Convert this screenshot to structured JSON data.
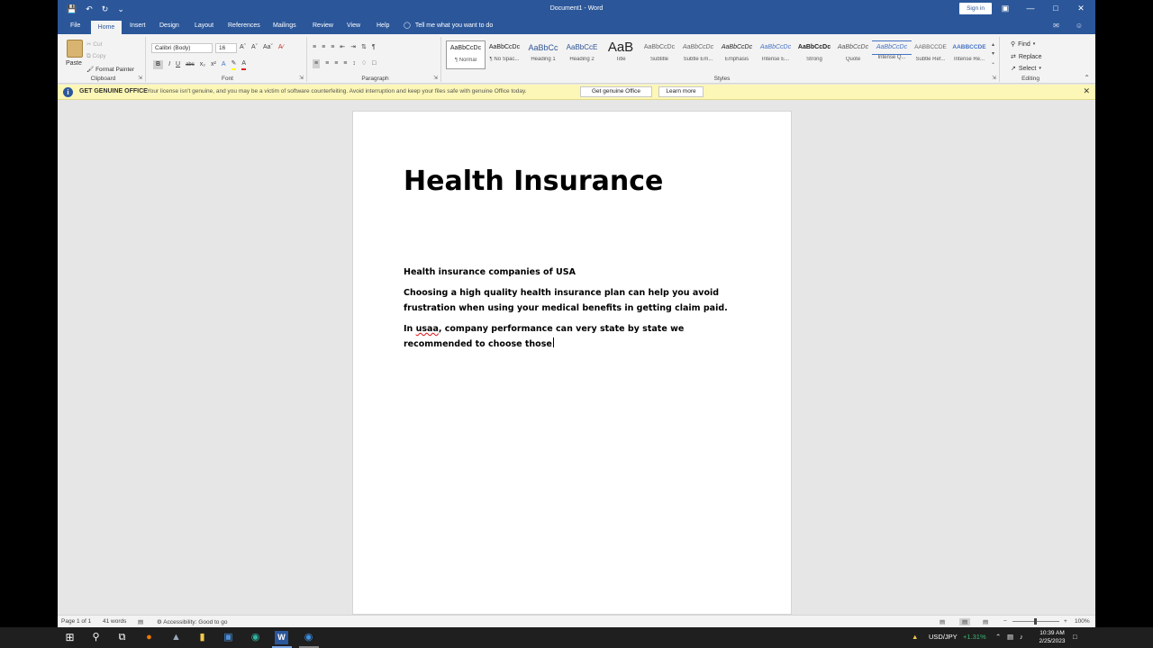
{
  "window": {
    "title": "Document1 - Word",
    "signin": "Sign in"
  },
  "tabs": [
    "File",
    "Home",
    "Insert",
    "Design",
    "Layout",
    "References",
    "Mailings",
    "Review",
    "View",
    "Help"
  ],
  "tell_me": "Tell me what you want to do",
  "ribbon": {
    "clipboard": {
      "label": "Clipboard",
      "paste": "Paste",
      "cut": "Cut",
      "copy": "Copy",
      "format_painter": "Format Painter"
    },
    "font": {
      "label": "Font",
      "name": "Calibri (Body)",
      "size": "16"
    },
    "paragraph": {
      "label": "Paragraph"
    },
    "styles": {
      "label": "Styles",
      "items": [
        {
          "sample": "AaBbCcDc",
          "name": "¶ Normal"
        },
        {
          "sample": "AaBbCcDc",
          "name": "¶ No Spac..."
        },
        {
          "sample": "AaBbCc",
          "name": "Heading 1"
        },
        {
          "sample": "AaBbCcE",
          "name": "Heading 2"
        },
        {
          "sample": "AaB",
          "name": "Title"
        },
        {
          "sample": "AaBbCcDc",
          "name": "Subtitle"
        },
        {
          "sample": "AaBbCcDc",
          "name": "Subtle Em..."
        },
        {
          "sample": "AaBbCcDc",
          "name": "Emphasis"
        },
        {
          "sample": "AaBbCcDc",
          "name": "Intense E..."
        },
        {
          "sample": "AaBbCcDc",
          "name": "Strong"
        },
        {
          "sample": "AaBbCcDc",
          "name": "Quote"
        },
        {
          "sample": "AaBbCcDc",
          "name": "Intense Q..."
        },
        {
          "sample": "AABBCCDE",
          "name": "Subtle Ref..."
        },
        {
          "sample": "AABBCCDE",
          "name": "Intense Re..."
        }
      ]
    },
    "editing": {
      "label": "Editing",
      "find": "Find",
      "replace": "Replace",
      "select": "Select"
    }
  },
  "infobar": {
    "title": "GET GENUINE OFFICE",
    "message": "Your license isn't genuine, and you may be a victim of software counterfeiting. Avoid interruption and keep your files safe with genuine Office today.",
    "button_genuine": "Get genuine Office",
    "button_learn": "Learn more"
  },
  "document": {
    "heading": "Health Insurance",
    "para1": "Health insurance companies of USA",
    "para2": "Choosing a high quality health insurance plan can help you avoid frustration when using your medical benefits in getting claim paid.",
    "para3_prefix": "In ",
    "para3_misspelled": "usaa",
    "para3_rest": ", company performance can very state by state  we recommended to choose those"
  },
  "statusbar": {
    "page": "Page 1 of 1",
    "words": "41 words",
    "accessibility": "Accessibility: Good to go",
    "zoom": "100%"
  },
  "tray": {
    "ticker": "USD/JPY",
    "change": "+1.31%",
    "time": "10:39 AM",
    "date": "2/25/2023"
  }
}
